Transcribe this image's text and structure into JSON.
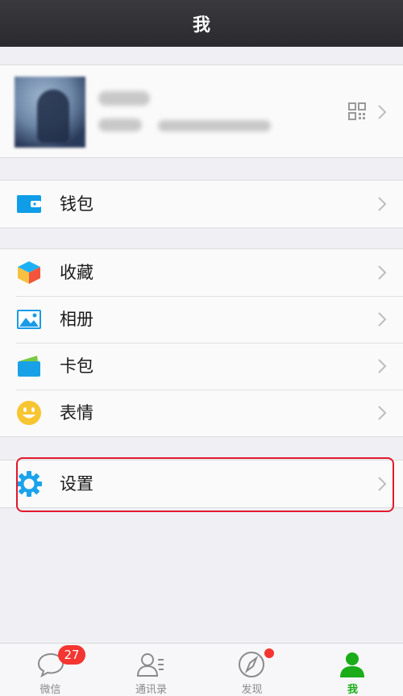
{
  "navbar": {
    "title": "我"
  },
  "menu": {
    "wallet": "钱包",
    "favorites": "收藏",
    "album": "相册",
    "cards": "卡包",
    "stickers": "表情",
    "settings": "设置"
  },
  "tabbar": {
    "chats": {
      "label": "微信",
      "badge": "27"
    },
    "contacts": {
      "label": "通讯录"
    },
    "discover": {
      "label": "发现"
    },
    "me": {
      "label": "我"
    }
  },
  "colors": {
    "active_tab": "#1aad19",
    "badge": "#f43530",
    "highlight": "#e0192c"
  }
}
